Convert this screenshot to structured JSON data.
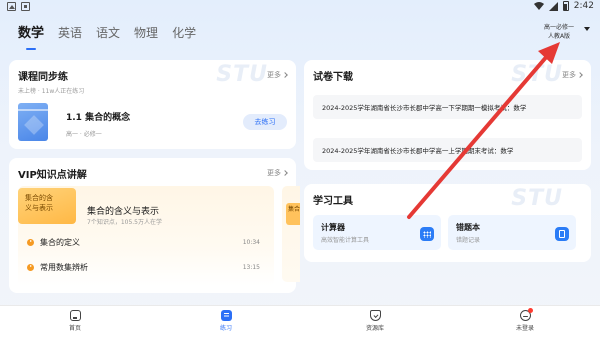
{
  "status_bar": {
    "time": "2:42",
    "left_icons": [
      "photo-icon",
      "download-icon"
    ],
    "right_icons": [
      "wifi-icon",
      "signal-icon",
      "battery-icon"
    ]
  },
  "subjects": {
    "tabs": [
      "数学",
      "英语",
      "语文",
      "物理",
      "化学"
    ],
    "active": "数学"
  },
  "textbook_selector": {
    "line1": "高一必修一",
    "line2": "人教A版"
  },
  "course_card": {
    "title": "课程同步练",
    "more": "更多",
    "meta": "未上榜 · 11w人正在练习",
    "lesson_title": "1.1 集合的概念",
    "lesson_sub": "高一 · 必修一",
    "practice_button": "去练习"
  },
  "vip_card": {
    "title": "VIP知识点讲解",
    "more": "更多",
    "tag_line1": "集合的含",
    "tag_line2": "义与表示",
    "topic_title": "集合的含义与表示",
    "topic_meta": "7个知识点，105.5万人在学",
    "rows": [
      {
        "label": "集合的定义",
        "time": "10:34"
      },
      {
        "label": "常用数集辨析",
        "time": "13:15"
      }
    ],
    "peek_tag": "集合"
  },
  "exam_card": {
    "title": "试卷下载",
    "more": "更多",
    "items": [
      "2024-2025学年湖南省长沙市长郡中学高一下学期期一模拟考试：数学",
      "2024-2025学年湖南省长沙市长郡中学高一上学期期末考试：数学"
    ]
  },
  "tools_card": {
    "title": "学习工具",
    "tools": [
      {
        "name": "计算器",
        "desc": "高效智能计算工具",
        "icon": "calculator-icon"
      },
      {
        "name": "错题本",
        "desc": "错题记录",
        "icon": "notebook-icon"
      }
    ]
  },
  "watermark": "STU",
  "bottom_nav": {
    "items": [
      {
        "label": "首页",
        "icon": "home-icon"
      },
      {
        "label": "练习",
        "icon": "practice-icon"
      },
      {
        "label": "资源库",
        "icon": "resource-icon"
      },
      {
        "label": "未登录",
        "icon": "user-icon"
      }
    ],
    "active": "练习"
  },
  "colors": {
    "accent": "#2b6ff6",
    "vip_orange": "#f59a23",
    "annotation_red": "#e53935"
  }
}
